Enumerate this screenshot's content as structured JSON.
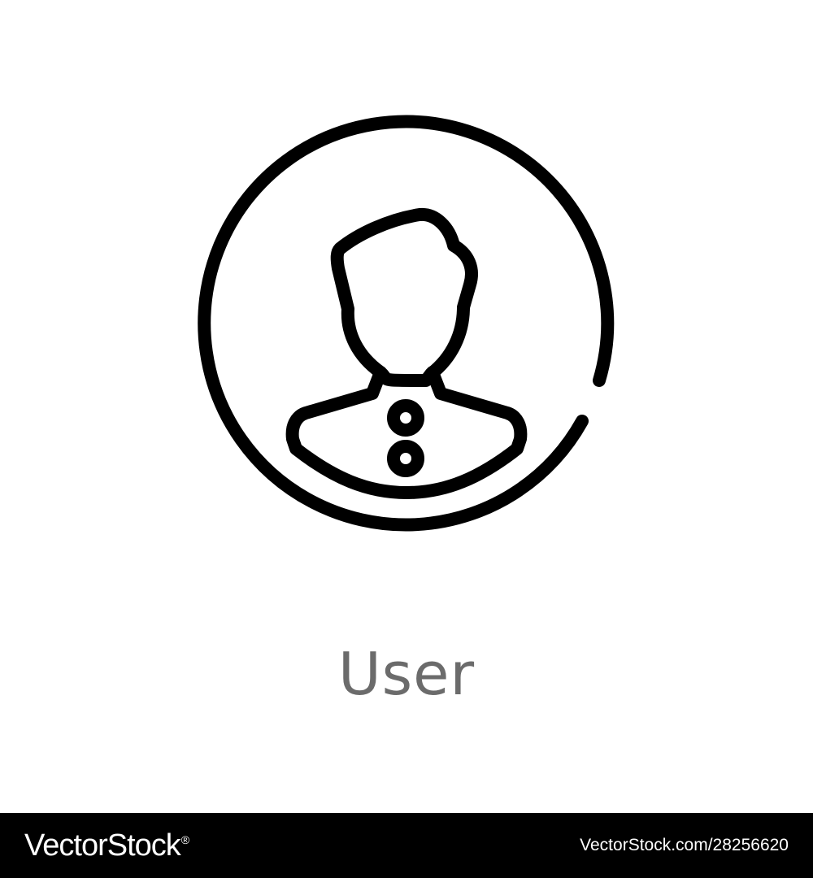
{
  "icon": {
    "name": "user-icon",
    "label": "User",
    "stroke_color": "#000000",
    "label_color": "#6b6b6b"
  },
  "watermark": {
    "brand": "VectorStock",
    "brand_mark": "®",
    "url": "VectorStock.com/28256620",
    "background_color": "#000000",
    "text_color": "#ffffff"
  },
  "colors": {
    "background": "#ffffff"
  }
}
